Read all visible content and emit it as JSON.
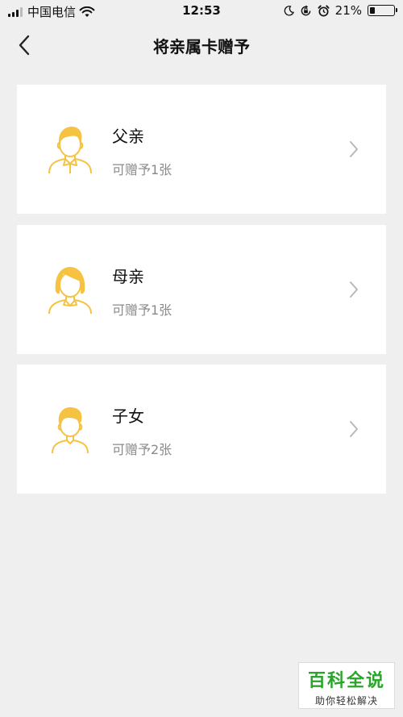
{
  "status_bar": {
    "carrier": "中国电信",
    "time": "12:53",
    "battery_percent": "21%",
    "battery_level": 0.21,
    "icons": [
      "signal-icon",
      "wifi-icon",
      "moon-icon",
      "rotation-lock-icon",
      "alarm-icon",
      "battery-icon"
    ]
  },
  "nav": {
    "title": "将亲属卡赠予",
    "back_icon": "chevron-left-icon"
  },
  "cards": [
    {
      "name": "父亲",
      "sub": "可赠予1张",
      "avatar": "father-avatar-icon"
    },
    {
      "name": "母亲",
      "sub": "可赠予1张",
      "avatar": "mother-avatar-icon"
    },
    {
      "name": "子女",
      "sub": "可赠予2张",
      "avatar": "child-avatar-icon"
    }
  ],
  "watermark": {
    "title": "百科全说",
    "subtitle": "助你轻松解决"
  },
  "colors": {
    "background": "#efefef",
    "card": "#ffffff",
    "avatar": "#f5c242",
    "sub_text": "#8a8a8a",
    "chevron": "#b8b8b8",
    "watermark_green": "#2aa52a"
  }
}
